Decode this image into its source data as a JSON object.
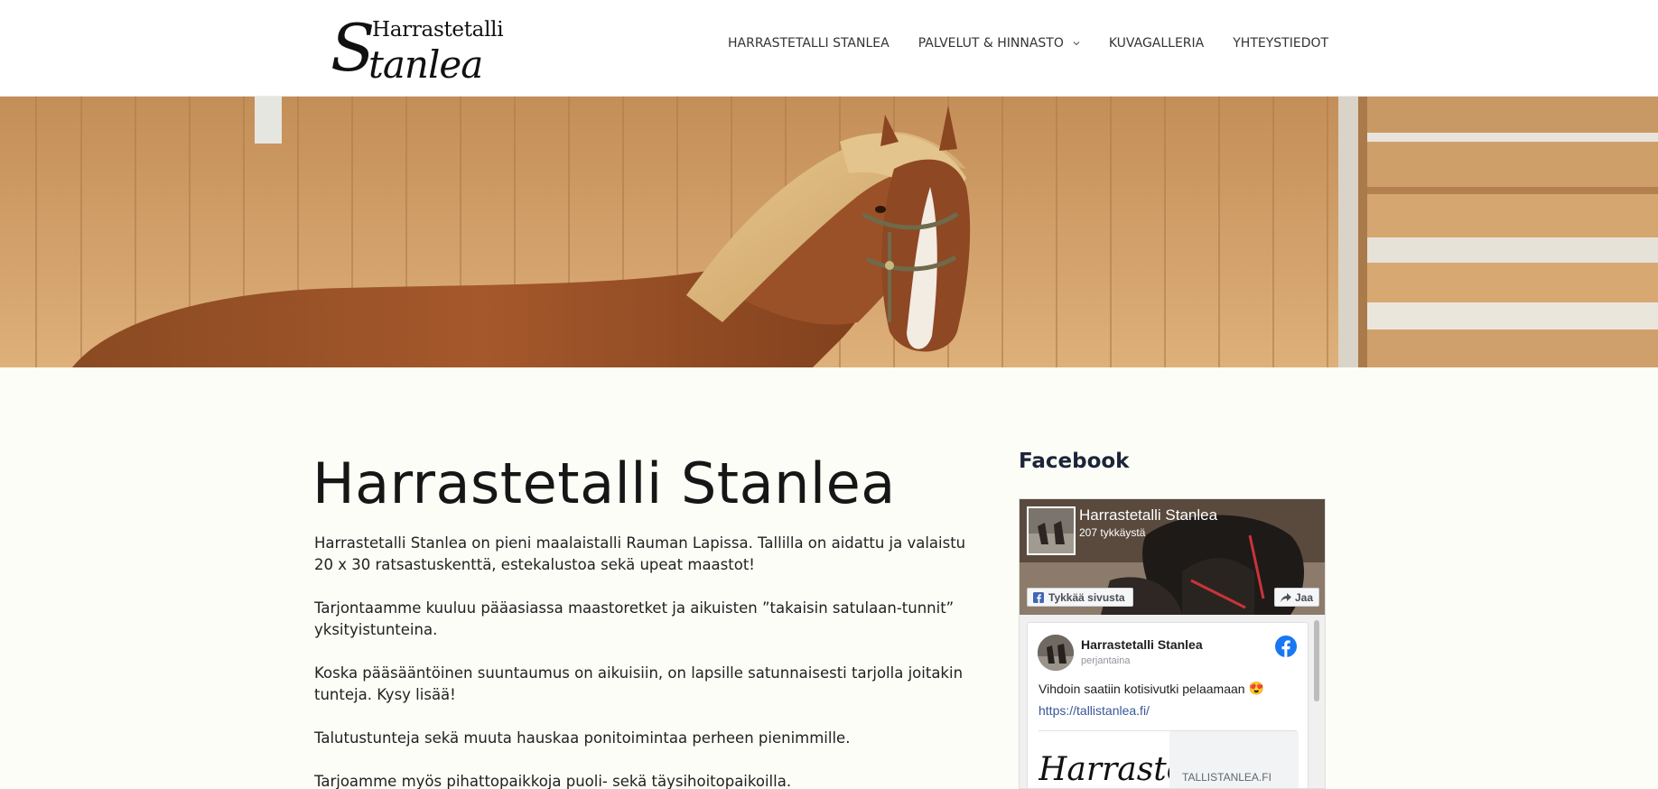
{
  "header": {
    "logo": {
      "small": "Harrastetalli",
      "big_s": "S",
      "big_rest": "tanlea"
    },
    "nav": [
      {
        "label": "HARRASTETALLI STANLEA"
      },
      {
        "label": "PALVELUT & HINNASTO",
        "has_dropdown": true
      },
      {
        "label": "KUVAGALLERIA"
      },
      {
        "label": "YHTEYSTIEDOT"
      }
    ]
  },
  "hero": {
    "image": "horse-in-arena-photo"
  },
  "main": {
    "title": "Harrastetalli Stanlea",
    "paragraphs": [
      "Harrastetalli Stanlea on pieni maalaistalli Rauman Lapissa. Tallilla on aidattu ja valaistu 20 x 30 ratsastuskenttä, estekalustoa sekä upeat maastot!",
      "Tarjontaamme kuuluu pääasiassa maastoretket ja aikuisten ”takaisin satulaan-tunnit” yksityistunteina.",
      "Koska pääsääntöinen suuntaumus on aikuisiin, on lapsille satunnaisesti tarjolla joitakin tunteja. Kysy lisää!",
      "Talutustunteja sekä muuta hauskaa ponitoimintaa perheen pienimmille.",
      "Tarjoamme myös pihattopaikkoja puoli- sekä täysihoitopaikoilla."
    ]
  },
  "sidebar": {
    "heading": "Facebook",
    "facebook": {
      "page_name": "Harrastetalli Stanlea",
      "likes": "207 tykkäystä",
      "like_button": "Tykkää sivusta",
      "share_button": "Jaa",
      "post": {
        "author": "Harrastetalli Stanlea",
        "time": "perjantaina",
        "text": "Vihdoin saatiin kotisivutki pelaamaan",
        "emoji": "😍",
        "link": "https://tallistanlea.fi/",
        "preview_image_text": "Harrastet",
        "preview_domain": "TALLISTANLEA.FI"
      }
    }
  },
  "colors": {
    "page_bg": "#fbfdf6",
    "header_bg": "#ffffff",
    "text": "#1d1d1d",
    "fb_blue": "#1877f2",
    "link": "#385898"
  }
}
